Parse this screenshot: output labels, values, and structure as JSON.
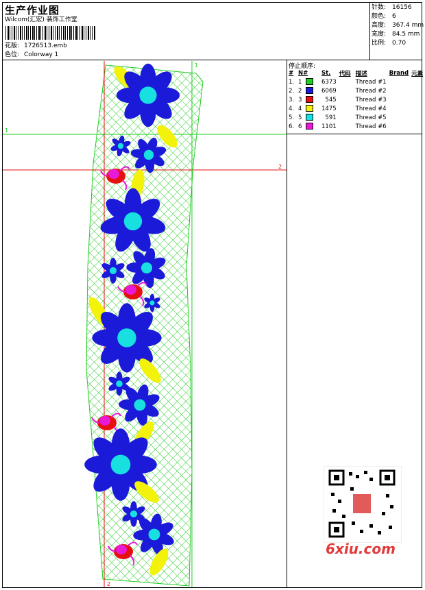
{
  "header": {
    "title": "生产作业图",
    "company": "Wilcom(汇宏) 装饰工作室",
    "design_label": "花版:",
    "design_value": "1726513.emb",
    "colorway_label": "色位:",
    "colorway_value": "Colorway 1"
  },
  "stats": [
    {
      "label": "针数:",
      "value": "16156"
    },
    {
      "label": "颜色:",
      "value": "6"
    },
    {
      "label": "高度:",
      "value": "367.4 mm"
    },
    {
      "label": "宽度:",
      "value": "84.5 mm"
    },
    {
      "label": "比例:",
      "value": "0.70"
    }
  ],
  "stop_sequence": {
    "title": "停止顺序:",
    "headers": [
      "#",
      "N#",
      "St.",
      "代码",
      "描述",
      "Brand",
      "元素"
    ],
    "rows": [
      {
        "n": "1.",
        "nn": "1",
        "color": "#22cc22",
        "st": "6373",
        "desc": "Thread #1"
      },
      {
        "n": "2.",
        "nn": "2",
        "color": "#1a1ad8",
        "st": "6069",
        "desc": "Thread #2"
      },
      {
        "n": "3.",
        "nn": "3",
        "color": "#e61010",
        "st": "545",
        "desc": "Thread #3"
      },
      {
        "n": "4.",
        "nn": "4",
        "color": "#f2f20a",
        "st": "1475",
        "desc": "Thread #4"
      },
      {
        "n": "5.",
        "nn": "5",
        "color": "#18e0e0",
        "st": "591",
        "desc": "Thread #5"
      },
      {
        "n": "6.",
        "nn": "6",
        "color": "#e81ad8",
        "st": "1101",
        "desc": "Thread #6"
      }
    ]
  },
  "guides": {
    "g1_top": "1",
    "g1_left": "1",
    "g2_right": "2",
    "g2_bottom": "2"
  },
  "watermark": "6xiu.com",
  "colors": {
    "green": "#22cc22",
    "blue": "#1a1ad8",
    "red": "#e61010",
    "yellow": "#f2f20a",
    "cyan": "#18e0e0",
    "magenta": "#e81ad8"
  }
}
